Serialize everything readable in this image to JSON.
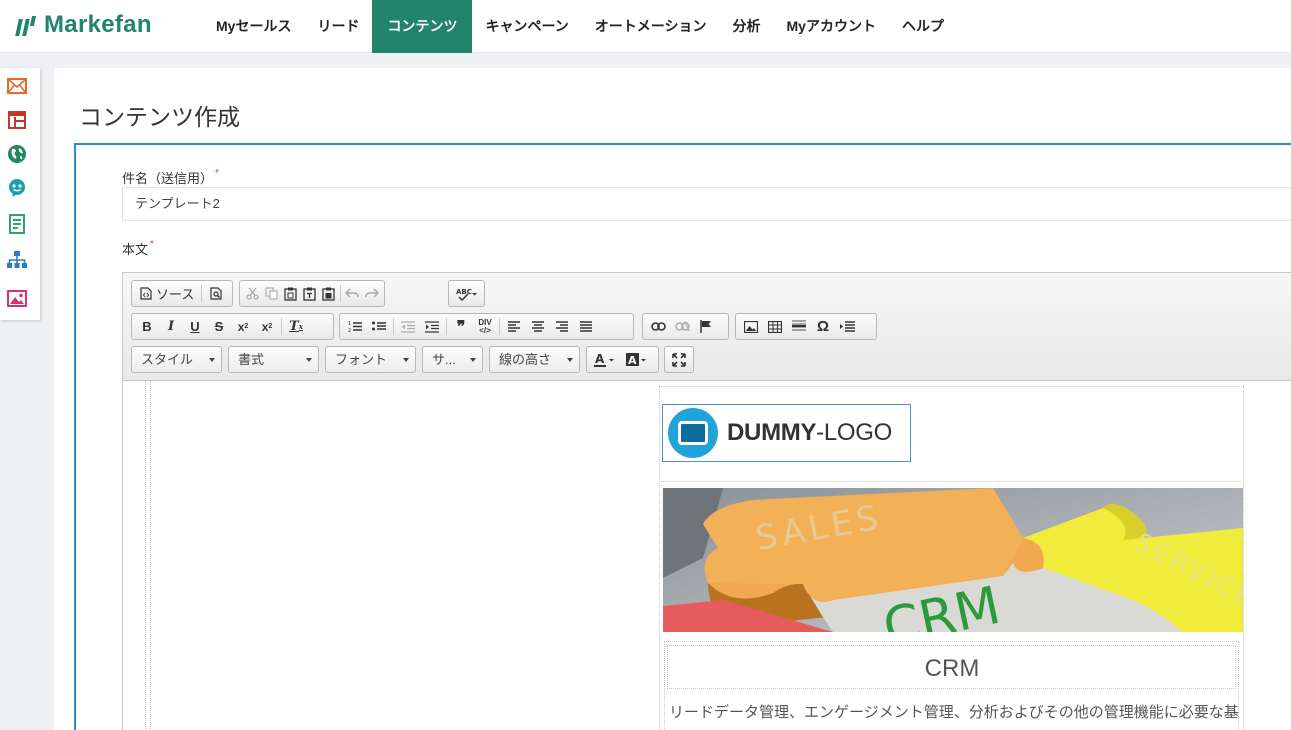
{
  "app": {
    "brand": "Markefan",
    "brand_color": "#22846d",
    "accent_blue": "#2b8bc3"
  },
  "nav": {
    "items": [
      {
        "label": "Myセールス"
      },
      {
        "label": "リード"
      },
      {
        "label": "コンテンツ",
        "active": true
      },
      {
        "label": "キャンペーン"
      },
      {
        "label": "オートメーション"
      },
      {
        "label": "分析"
      },
      {
        "label": "Myアカウント"
      },
      {
        "label": "ヘルプ"
      }
    ]
  },
  "rail": {
    "icons": [
      "mail-icon",
      "layout-icon",
      "globe-icon",
      "chat-bot-icon",
      "form-icon",
      "sitemap-icon",
      "image-icon"
    ]
  },
  "page": {
    "title": "コンテンツ作成"
  },
  "form": {
    "subject_label": "件名（送信用）",
    "subject_value": "テンプレート2",
    "body_label": "本文",
    "required_mark": "*"
  },
  "editor": {
    "toolbar_row1": {
      "source_label": "ソース"
    },
    "combos": {
      "style": "スタイル",
      "format": "書式",
      "font": "フォント",
      "size": "サ...",
      "line_height": "線の高さ"
    },
    "content": {
      "logo_bold": "DUMMY",
      "logo_rest": "-LOGO",
      "hero_words": [
        "SALES",
        "SERVICE",
        "CRM"
      ],
      "section_title": "CRM",
      "section_text": "リードデータ管理、エンゲージメント管理、分析およびその他の管理機能に必要な基"
    }
  }
}
